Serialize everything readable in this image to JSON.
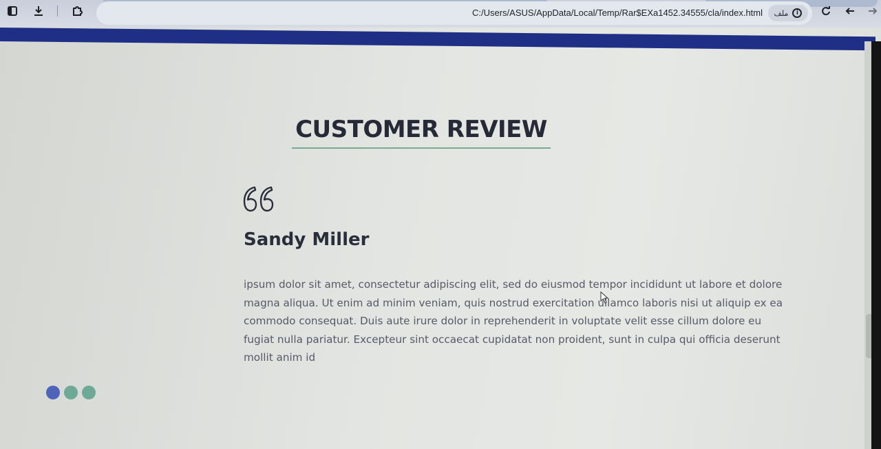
{
  "browser": {
    "url": "C:/Users/ASUS/AppData/Local/Temp/Rar$EXa1452.34555/cla/index.html",
    "file_label": "ملف",
    "icons": [
      "sidebar-icon",
      "download-icon",
      "extensions-icon",
      "star-icon",
      "info-icon",
      "reload-icon",
      "back-icon",
      "forward-icon"
    ]
  },
  "review": {
    "section_title": "CUSTOMER REVIEW",
    "reviewer_name": "Sandy Miller",
    "text": "ipsum dolor sit amet, consectetur adipiscing elit, sed do eiusmod tempor incididunt ut labore et dolore magna aliqua. Ut enim ad minim veniam, quis nostrud exercitation ullamco laboris nisi ut aliquip ex ea commodo consequat. Duis aute irure dolor in reprehenderit in voluptate velit esse cillum dolore eu fugiat nulla pariatur. Excepteur sint occaecat cupidatat non proident, sunt in culpa qui officia deserunt mollit anim id"
  },
  "colors": {
    "header_bar": "#1f2f86",
    "title": "#262a36",
    "underline": "#7aa992",
    "dot_active": "#4f64b8",
    "dot_inactive": "#6ea896"
  },
  "carousel": {
    "dots": [
      {
        "state": "active"
      },
      {
        "state": "inactive"
      },
      {
        "state": "inactive"
      }
    ]
  }
}
